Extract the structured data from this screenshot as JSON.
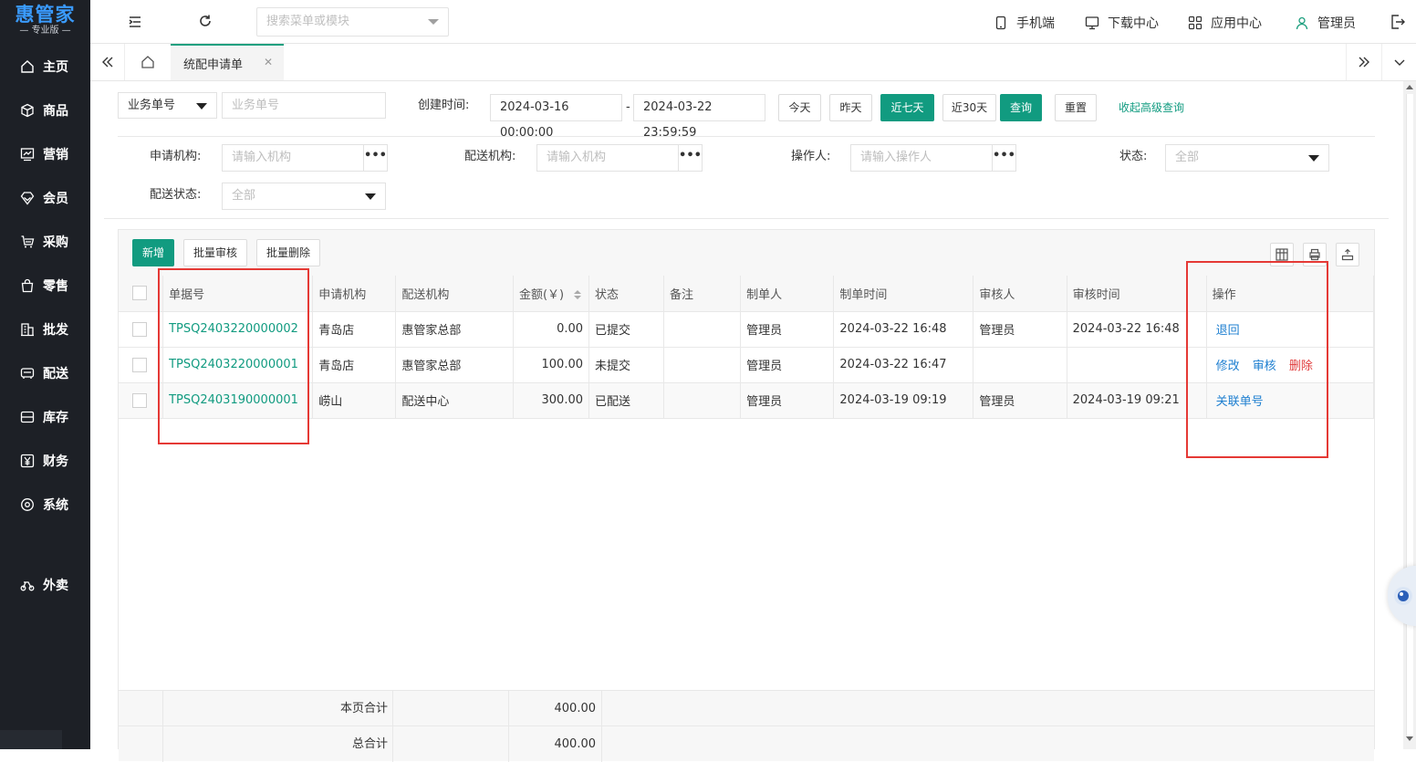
{
  "brand": {
    "name": "惠管家",
    "edition": "— 专业版 —"
  },
  "sidebar": {
    "items": [
      {
        "label": "主页",
        "icon": "home-icon"
      },
      {
        "label": "商品",
        "icon": "box-icon"
      },
      {
        "label": "营销",
        "icon": "chart-icon"
      },
      {
        "label": "会员",
        "icon": "diamond-icon"
      },
      {
        "label": "采购",
        "icon": "cart-icon"
      },
      {
        "label": "零售",
        "icon": "bag-icon"
      },
      {
        "label": "批发",
        "icon": "building-icon"
      },
      {
        "label": "配送",
        "icon": "truck-icon"
      },
      {
        "label": "库存",
        "icon": "inbox-icon"
      },
      {
        "label": "财务",
        "icon": "yen-icon"
      },
      {
        "label": "系统",
        "icon": "settings-icon"
      },
      {
        "label": "外卖",
        "icon": "bike-icon"
      }
    ]
  },
  "topbar": {
    "search_placeholder": "搜索菜单或模块",
    "mobile": "手机端",
    "download": "下载中心",
    "apps": "应用中心",
    "user": "管理员"
  },
  "tabs": {
    "active": "统配申请单"
  },
  "filters": {
    "doc_type": "业务单号",
    "doc_no_placeholder": "业务单号",
    "created_label": "创建时间:",
    "date_from": "2024-03-16 00:00:00",
    "date_sep": "-",
    "date_to": "2024-03-22 23:59:59",
    "today": "今天",
    "yesterday": "昨天",
    "last7": "近七天",
    "last30": "近30天",
    "query": "查询",
    "reset": "重置",
    "collapse": "收起高级查询",
    "req_org_label": "申请机构:",
    "req_org_placeholder": "请输入机构",
    "dist_org_label": "配送机构:",
    "dist_org_placeholder": "请输入机构",
    "operator_label": "操作人:",
    "operator_placeholder": "请输入操作人",
    "status_label": "状态:",
    "status_value": "全部",
    "dist_status_label": "配送状态:",
    "dist_status_value": "全部",
    "dots": "•••"
  },
  "toolbar": {
    "add": "新增",
    "batch_audit": "批量审核",
    "batch_delete": "批量删除"
  },
  "table": {
    "headers": [
      "单据号",
      "申请机构",
      "配送机构",
      "金额(￥)",
      "状态",
      "备注",
      "制单人",
      "制单时间",
      "审核人",
      "审核时间",
      "操作"
    ],
    "rows": [
      {
        "no": "TPSQ2403220000002",
        "req_org": "青岛店",
        "dist_org": "惠管家总部",
        "amount": "0.00",
        "status": "已提交",
        "note": "",
        "maker": "管理员",
        "made_at": "2024-03-22 16:48",
        "auditor": "管理员",
        "audited_at": "2024-03-22 16:48",
        "ops": [
          "退回"
        ]
      },
      {
        "no": "TPSQ2403220000001",
        "req_org": "青岛店",
        "dist_org": "惠管家总部",
        "amount": "100.00",
        "status": "未提交",
        "note": "",
        "maker": "管理员",
        "made_at": "2024-03-22 16:47",
        "auditor": "",
        "audited_at": "",
        "ops": [
          "修改",
          "审核",
          "删除"
        ]
      },
      {
        "no": "TPSQ2403190000001",
        "req_org": "崂山",
        "dist_org": "配送中心",
        "amount": "300.00",
        "status": "已配送",
        "note": "",
        "maker": "管理员",
        "made_at": "2024-03-19 09:19",
        "auditor": "管理员",
        "audited_at": "2024-03-19 09:21",
        "ops": [
          "关联单号"
        ]
      }
    ],
    "page_total_label": "本页合计",
    "page_total": "400.00",
    "grand_total_label": "总合计",
    "grand_total": "400.00"
  },
  "colors": {
    "accent": "#119b80",
    "sidebar_bg": "#1d2026",
    "link": "#1e7fd0",
    "danger": "#e03b3b",
    "highlight": "#e53935"
  }
}
